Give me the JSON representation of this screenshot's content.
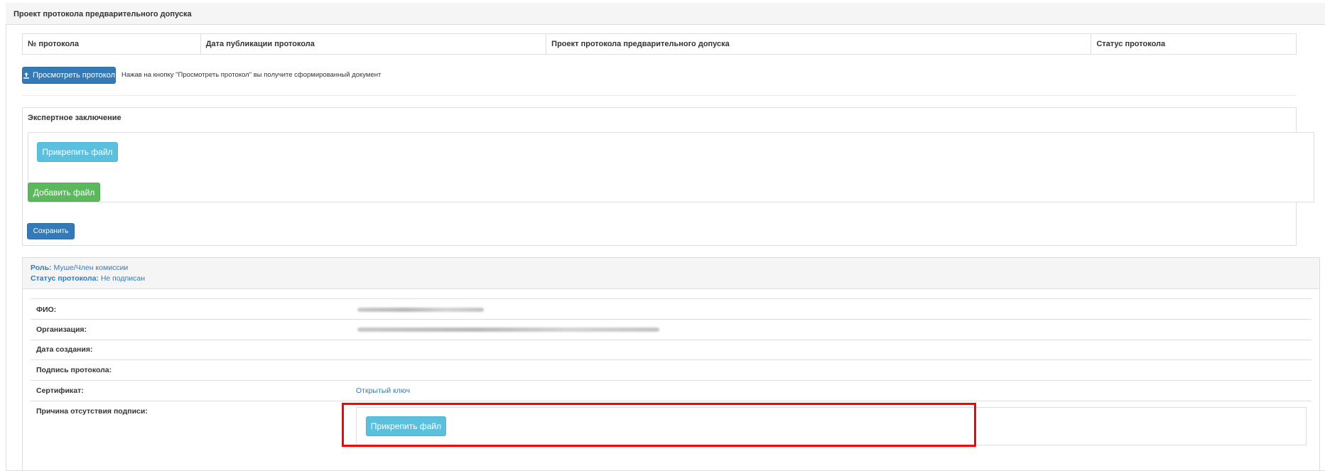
{
  "panel": {
    "title": "Проект протокола предварительного допуска"
  },
  "protocol_table": {
    "headers": [
      "№ протокола",
      "Дата публикации протокола",
      "Проект протокола предварительного допуска",
      "Статус протокола"
    ]
  },
  "view_protocol": {
    "button_label": "Просмотреть протокол",
    "hint": "Нажав на кнопку \"Просмотреть протокол\" вы получите сформированный документ"
  },
  "expert": {
    "title": "Экспертное заключение",
    "attach_label": "Прикрепить файл",
    "add_file_label": "Добавить файл"
  },
  "save_label": "Сохранить",
  "signer": {
    "role_label": "Роль:",
    "role_value": "Муше/Член комиссии",
    "status_label": "Статус протокола:",
    "status_value": "Не подписан",
    "fields": {
      "fio": "ФИО:",
      "org": "Организация:",
      "created": "Дата создания:",
      "signature": "Подпись протокола:",
      "certificate": "Сертификат:",
      "reason": "Причина отсутствия подписи:"
    },
    "certificate_link": "Открытый ключ",
    "attach_label": "Прикрепить файл"
  },
  "colors": {
    "primary": "#337ab7",
    "info": "#5bc0de",
    "success": "#5cb85c",
    "highlight": "#ff0000"
  }
}
